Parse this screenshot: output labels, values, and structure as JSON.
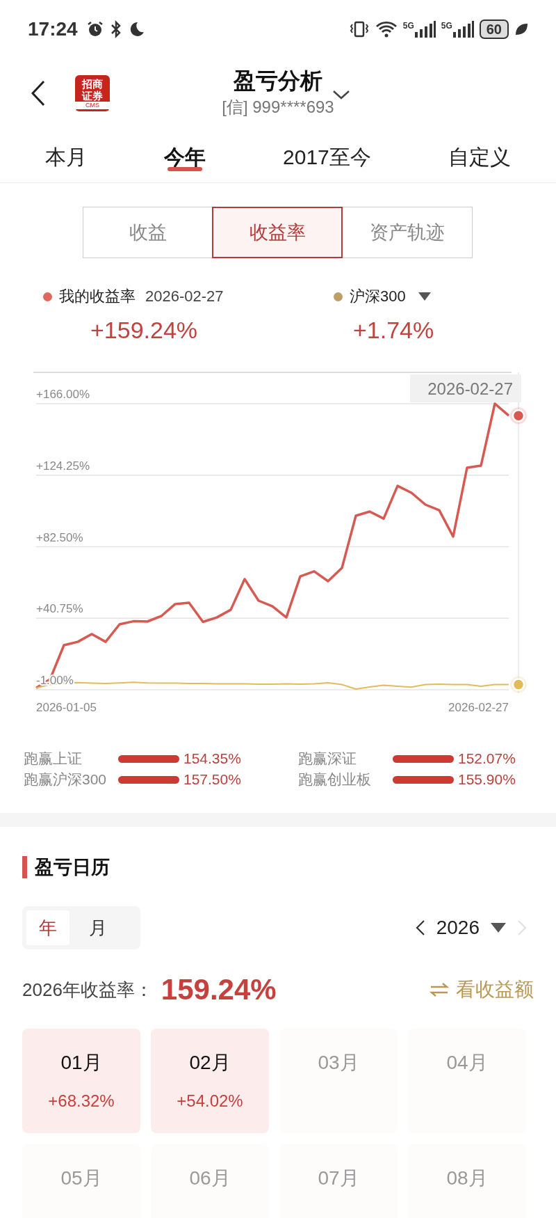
{
  "status_bar": {
    "time": "17:24",
    "network_1": "5G",
    "network_2": "5G",
    "battery": "60"
  },
  "header": {
    "logo_lines": [
      "招商",
      "证券"
    ],
    "logo_caption": "CMS",
    "title": "盈亏分析",
    "account": "[信] 999****693"
  },
  "period_tabs": [
    {
      "label": "本月",
      "selected": false
    },
    {
      "label": "今年",
      "selected": true
    },
    {
      "label": "2017至今",
      "selected": false
    },
    {
      "label": "自定义",
      "selected": false
    }
  ],
  "view_tabs": [
    {
      "label": "收益",
      "selected": false
    },
    {
      "label": "收益率",
      "selected": true
    },
    {
      "label": "资产轨迹",
      "selected": false
    }
  ],
  "legend": [
    {
      "date": "2026-02-27",
      "value": "+159.24%",
      "color": "#e0675c",
      "has_menu": false
    },
    {
      "value": "+1.74%",
      "color": "#bf9f68",
      "has_menu": true
    }
  ],
  "chart": {
    "tooltip_date": "2026-02-27",
    "x_axis_labels": [
      "2026-01-05",
      "2026-02-27"
    ],
    "chart_data": {
      "type": "line",
      "ylim": [
        -1,
        166
      ],
      "grid": true,
      "yticks": [
        {
          "value": -1,
          "label": "-1.00%"
        },
        {
          "value": 40.75,
          "label": "+40.75%"
        },
        {
          "value": 82.5,
          "label": "+82.50%"
        },
        {
          "value": 124.25,
          "label": "+124.25%"
        },
        {
          "value": 166,
          "label": "+166.00%"
        }
      ],
      "series": [
        {
          "name": "我的收益率",
          "color": "#d65a52",
          "values": [
            0,
            5.1,
            25,
            27,
            31.5,
            27,
            37.2,
            39,
            38.8,
            42,
            49,
            49.8,
            38.6,
            41.2,
            45.7,
            63.6,
            51,
            47.7,
            41.2,
            65.2,
            68.1,
            62.4,
            70.1,
            100.6,
            103,
            98.9,
            118,
            114,
            107.1,
            103.8,
            88.4,
            128.6,
            129.8,
            166,
            159
          ]
        },
        {
          "name": "沪深300",
          "color": "#e0bd5a",
          "values": [
            0,
            2,
            3,
            3.2,
            2.8,
            2.6,
            3,
            3.4,
            3,
            2.8,
            2.9,
            2.6,
            2.7,
            2.4,
            2.5,
            2.5,
            2.3,
            2.3,
            2.4,
            2.3,
            2.4,
            3.1,
            2,
            -0.6,
            0.6,
            1.6,
            1,
            0.5,
            2,
            2.2,
            2,
            2,
            1,
            2,
            2
          ]
        }
      ]
    }
  },
  "outperformance": [
    {
      "label": "跑赢上证",
      "value": "154.35%"
    },
    {
      "label": "跑赢深证",
      "value": "152.07%"
    },
    {
      "label": "跑赢沪深300",
      "value": "157.50%"
    },
    {
      "label": "跑赢创业板",
      "value": "155.90%"
    }
  ],
  "calendar": {
    "title": "盈亏日历",
    "modes": [
      {
        "label": "年",
        "selected": true
      },
      {
        "label": "月",
        "selected": false
      }
    ],
    "year": "2026",
    "next_disabled": true,
    "summary_label": "2026年收益率：",
    "summary_value": "159.24%",
    "switch_label": "看收益额",
    "months": [
      {
        "label": "01月",
        "value": "+68.32%",
        "active": true
      },
      {
        "label": "02月",
        "value": "+54.02%",
        "active": true
      },
      {
        "label": "03月",
        "active": false
      },
      {
        "label": "04月",
        "active": false
      },
      {
        "label": "05月",
        "active": false
      },
      {
        "label": "06月",
        "active": false
      },
      {
        "label": "07月",
        "active": false
      },
      {
        "label": "08月",
        "active": false
      }
    ]
  }
}
